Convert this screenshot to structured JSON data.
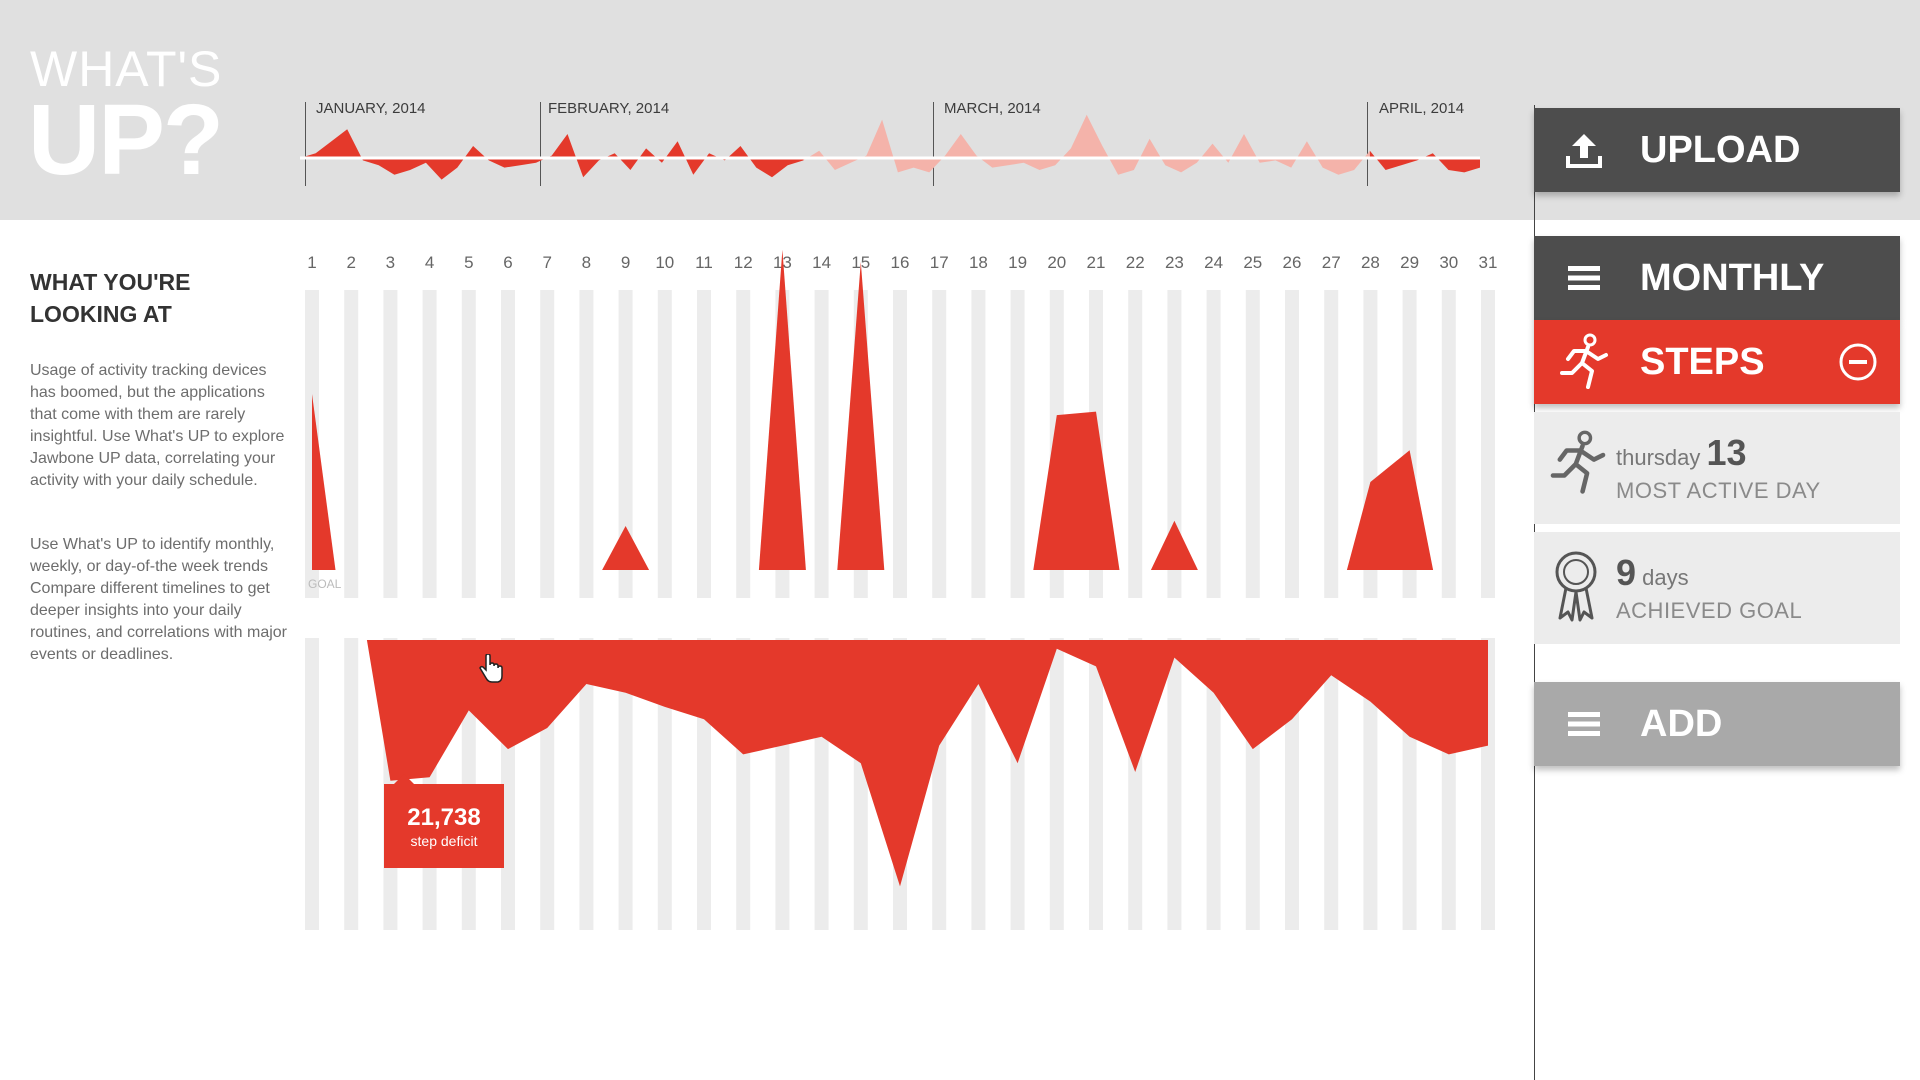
{
  "app": {
    "title_line1": "WHAT'S",
    "title_line2": "UP?"
  },
  "colors": {
    "accent": "#e4392b",
    "deficit_highlight": "#f0a296",
    "overview_faded": "#f4b3aa",
    "dark_button": "#4d4d4d",
    "grey_button": "#a9a9a9",
    "bar_track": "#ececec"
  },
  "overview": {
    "months": [
      "JANUARY, 2014",
      "FEBRUARY, 2014",
      "MARCH, 2014",
      "APRIL, 2014"
    ],
    "series": [
      0,
      4,
      14,
      24,
      -2,
      -6,
      -14,
      -10,
      -4,
      -18,
      -8,
      10,
      -2,
      -8,
      -6,
      -4,
      2,
      20,
      -16,
      -2,
      4,
      -10,
      8,
      -4,
      14,
      -14,
      4,
      -2,
      10,
      -8,
      -16,
      -6,
      -2,
      6,
      -10,
      -4,
      2,
      32,
      -12,
      -8,
      -12,
      2,
      20,
      2,
      -8,
      -6,
      -4,
      -10,
      -6,
      8,
      36,
      10,
      -14,
      -10,
      16,
      -6,
      -12,
      -4,
      12,
      -4,
      20,
      -4,
      -2,
      -8,
      14,
      -8,
      -14,
      -10,
      6,
      -10,
      -6,
      -2,
      4,
      -10,
      -12,
      -8
    ]
  },
  "sidebar": {
    "heading": "WHAT YOU'RE LOOKING AT",
    "paragraph1": "Usage of activity tracking devices has boomed, but the applications that come with them are rarely insightful. Use What's UP to explore Jawbone UP data, correlating your activity with your daily schedule.",
    "paragraph2": "Use What's UP to identify monthly, weekly, or day-of-the week trends Compare different timelines to  get deeper insights into your daily routines, and correlations with major events or deadlines."
  },
  "chart_data": {
    "type": "area",
    "title": "",
    "goal_label": "GOAL",
    "days": [
      "1",
      "2",
      "3",
      "4",
      "5",
      "6",
      "7",
      "8",
      "9",
      "10",
      "11",
      "12",
      "13",
      "14",
      "15",
      "16",
      "17",
      "18",
      "19",
      "20",
      "21",
      "22",
      "23",
      "24",
      "25",
      "26",
      "27",
      "28",
      "29",
      "30",
      "31"
    ],
    "series": [
      {
        "values": [
          1.0,
          0,
          0,
          0,
          0,
          0,
          0,
          0,
          0.25,
          0,
          0,
          0,
          1.82,
          0,
          1.75,
          0,
          0,
          0,
          0,
          0.88,
          0.9,
          0,
          0.28,
          0,
          0,
          0,
          0,
          0.5,
          0.68,
          0,
          0
        ]
      },
      {
        "values": [
          0,
          0,
          -0.8,
          -0.78,
          -0.4,
          -0.62,
          -0.5,
          -0.25,
          -0.3,
          -0.38,
          -0.45,
          -0.65,
          -0.6,
          -0.55,
          -0.7,
          -1.4,
          -0.6,
          -0.25,
          -0.7,
          -0.05,
          -0.15,
          -0.75,
          -0.1,
          -0.3,
          -0.62,
          -0.45,
          -0.2,
          -0.35,
          -0.55,
          -0.65,
          -0.6
        ]
      }
    ],
    "highlight_range": [
      "2",
      "9"
    ],
    "tooltip": {
      "day": "3",
      "value": "21,738",
      "label": "step deficit"
    },
    "ylim": [
      -1.5,
      2.0
    ],
    "grid": false
  },
  "panel": {
    "upload_label": "UPLOAD",
    "monthly_label": "MONTHLY",
    "steps_label": "STEPS",
    "most_active": {
      "weekday": "thursday",
      "day": "13",
      "label": "MOST ACTIVE DAY"
    },
    "goal": {
      "count": "9",
      "unit": "days",
      "label": "ACHIEVED GOAL"
    },
    "add_label": "ADD"
  }
}
